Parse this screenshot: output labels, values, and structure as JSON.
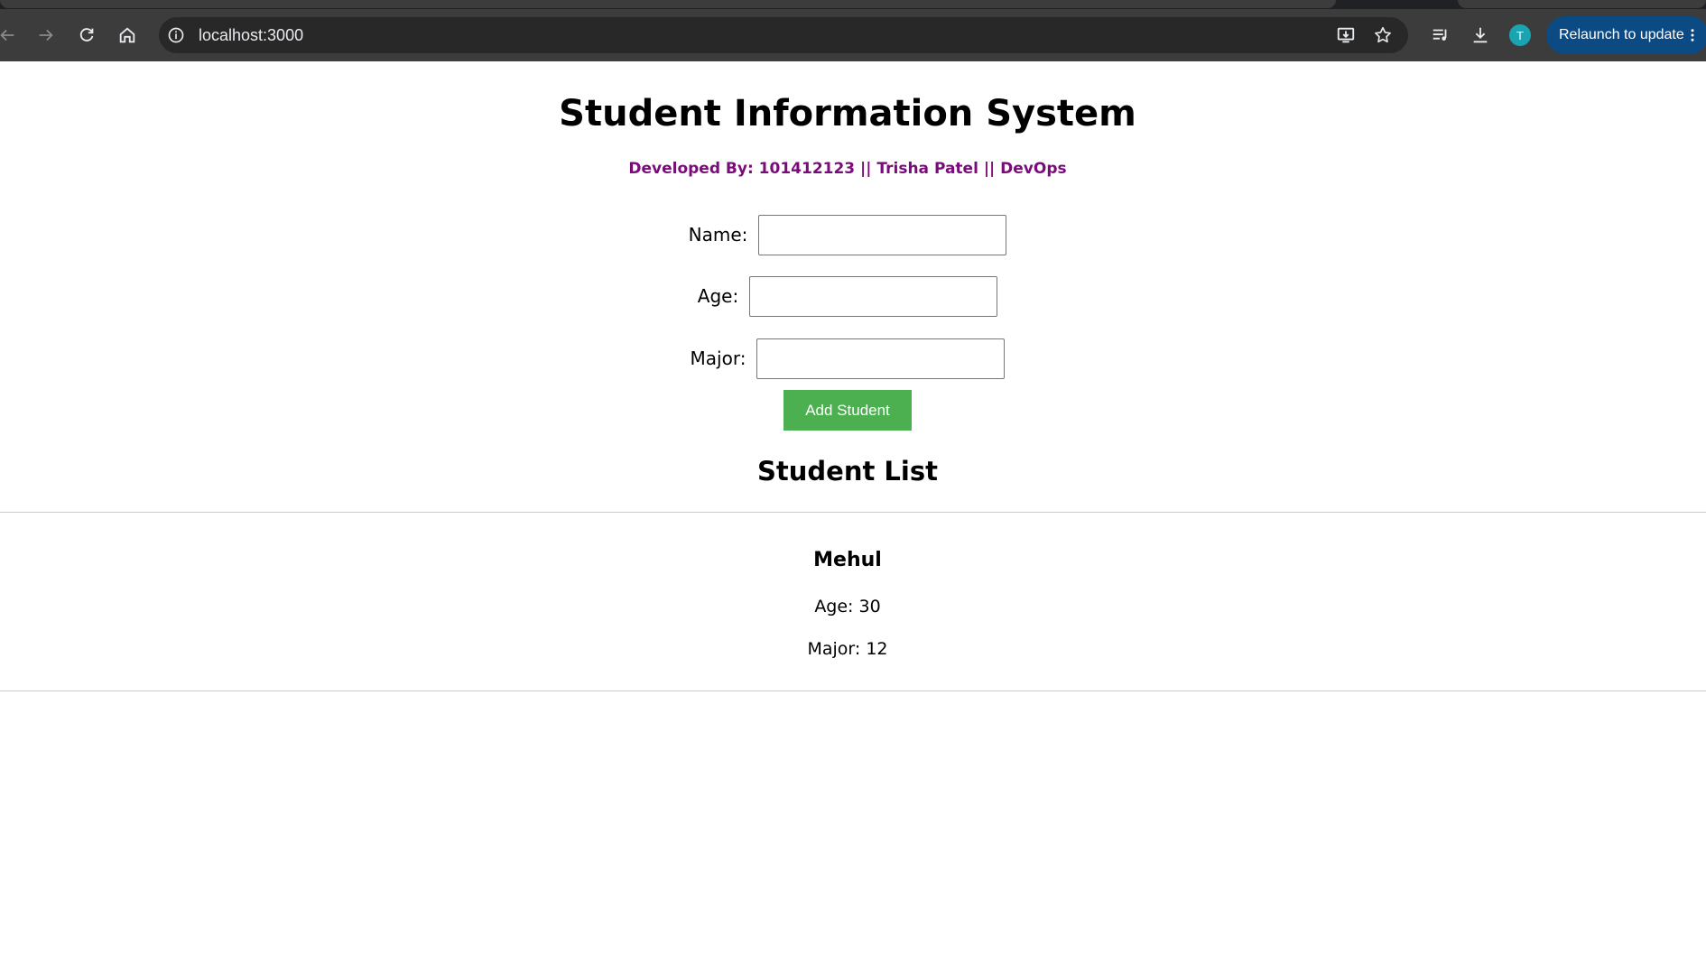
{
  "browser": {
    "url": "localhost:3000",
    "profile_initial": "T",
    "relaunch_label": "Relaunch to update",
    "icons": [
      "back-arrow-icon",
      "forward-arrow-icon",
      "reload-icon",
      "home-icon",
      "site-info-icon",
      "install-app-icon",
      "bookmark-star-icon",
      "media-queue-icon",
      "download-icon",
      "more-vert-icon"
    ]
  },
  "page": {
    "title": "Student Information System",
    "byline": "Developed By: 101412123 || Trisha Patel || DevOps",
    "byline_color": "#7a0c7a"
  },
  "form": {
    "name_label": "Name:",
    "name_value": "",
    "age_label": "Age:",
    "age_value": "",
    "major_label": "Major:",
    "major_value": "",
    "submit_label": "Add Student",
    "submit_color": "#4caf50"
  },
  "list": {
    "heading": "Student List",
    "students": [
      {
        "name": "Mehul",
        "age_text": "Age: 30",
        "major_text": "Major: 12"
      }
    ]
  }
}
